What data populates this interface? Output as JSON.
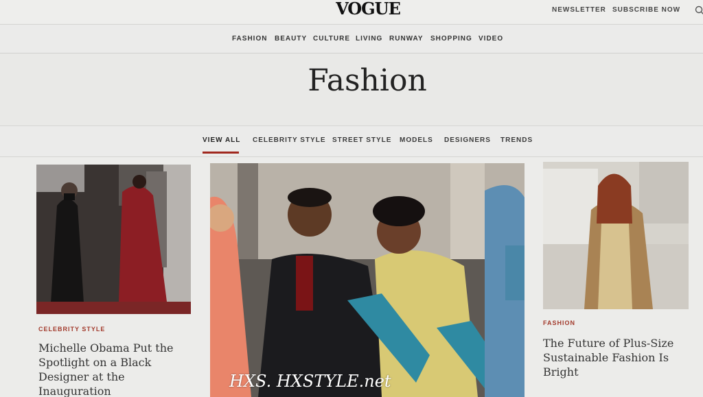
{
  "header": {
    "logo": "VOGUE",
    "newsletter": "NEWSLETTER",
    "subscribe": "SUBSCRIBE NOW",
    "icon": "search-icon"
  },
  "nav": [
    "FASHION",
    "BEAUTY",
    "CULTURE",
    "LIVING",
    "RUNWAY",
    "SHOPPING",
    "VIDEO"
  ],
  "page": {
    "title": "Fashion"
  },
  "subnav": [
    "VIEW ALL",
    "CELEBRITY STYLE",
    "STREET STYLE",
    "MODELS",
    "DESIGNERS",
    "TRENDS"
  ],
  "articles": [
    {
      "kicker": "CELEBRITY STYLE",
      "headline": "Michelle Obama Put the Spotlight on a Black Designer at the Inauguration"
    },
    {
      "kicker": "FASHION",
      "headline": "The Future of Plus-Size Sustainable Fashion Is Bright"
    }
  ],
  "watermark": "HXS. HXSTYLE.net",
  "colors": {
    "accent": "#a0281e",
    "kicker": "#a23a2c",
    "background": "#e9e9e7"
  }
}
